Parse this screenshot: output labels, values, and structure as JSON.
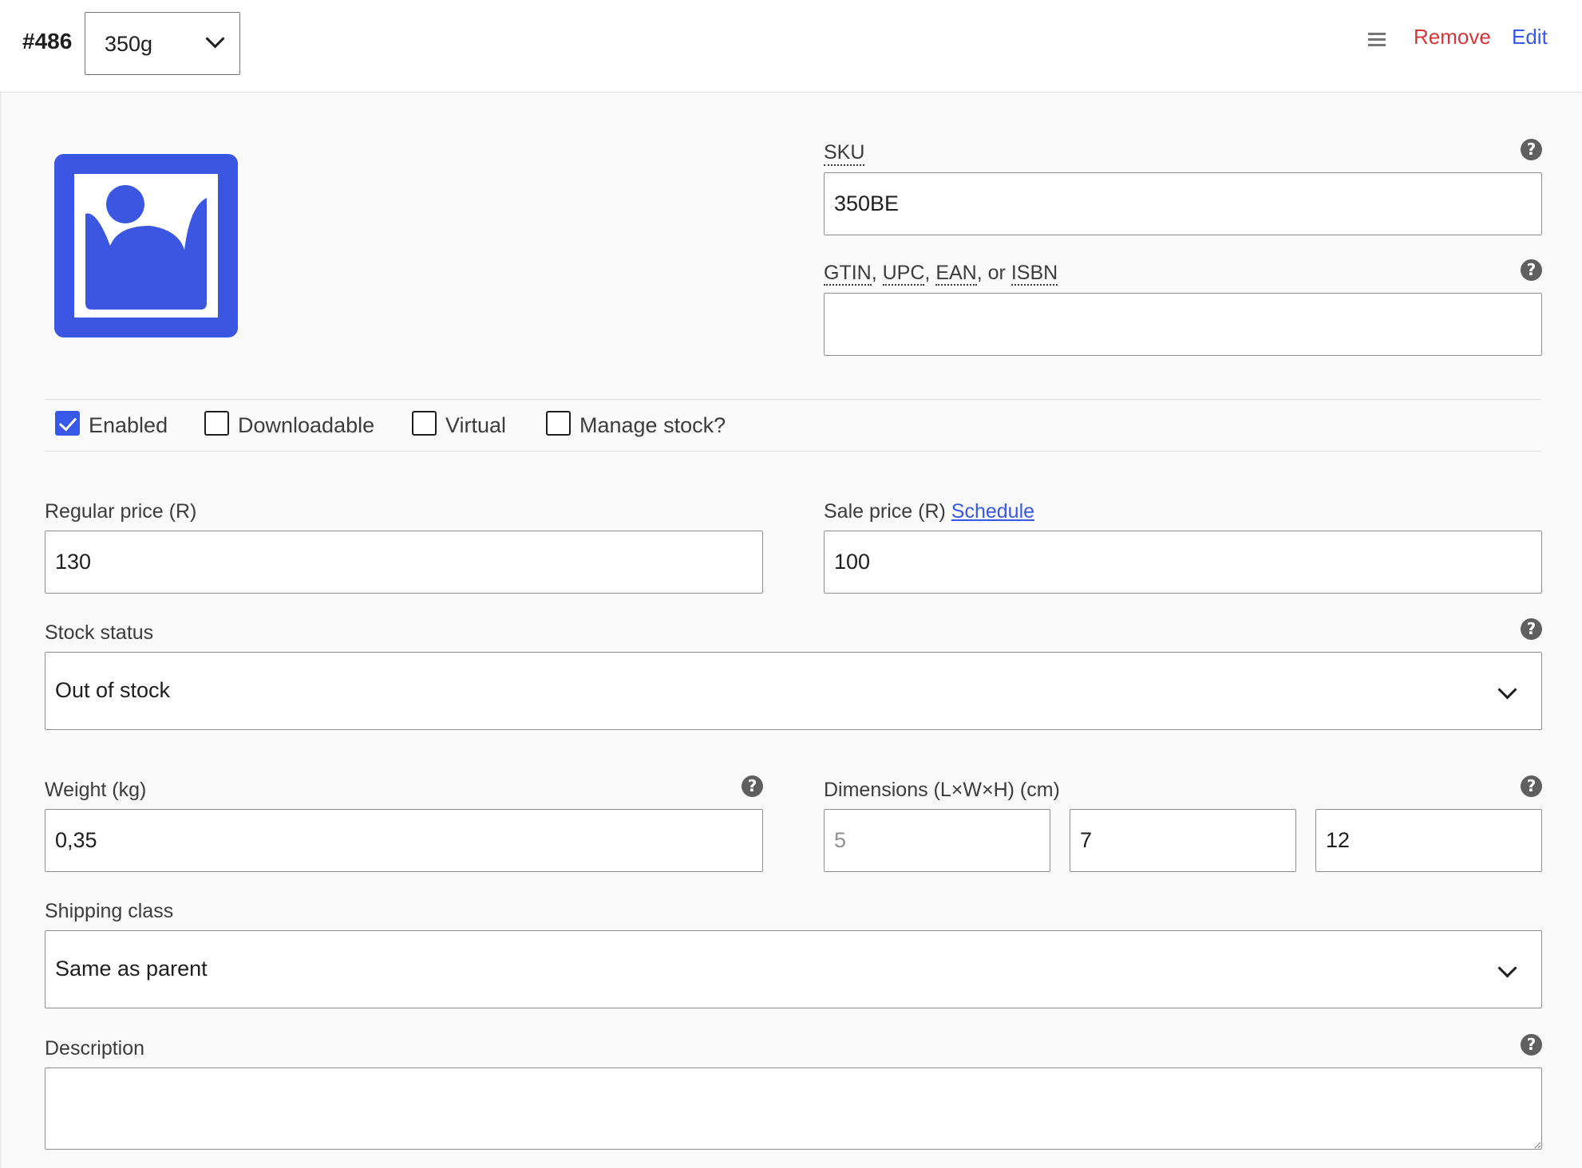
{
  "header": {
    "variation_id": "#486",
    "attribute_value": "350g",
    "remove_label": "Remove",
    "edit_label": "Edit"
  },
  "fields": {
    "sku": {
      "label": "SKU",
      "value": "350BE"
    },
    "gtin": {
      "label_parts": [
        "GTIN",
        "UPC",
        "EAN",
        "ISBN"
      ],
      "separator": ", ",
      "or_word": "or",
      "value": ""
    },
    "options": [
      {
        "label": "Enabled",
        "checked": true
      },
      {
        "label": "Downloadable",
        "checked": false
      },
      {
        "label": "Virtual",
        "checked": false
      },
      {
        "label": "Manage stock?",
        "checked": false
      }
    ],
    "regular_price": {
      "label": "Regular price (R)",
      "value": "130"
    },
    "sale_price": {
      "label": "Sale price (R)",
      "link": "Schedule",
      "value": "100"
    },
    "stock_status": {
      "label": "Stock status",
      "value": "Out of stock"
    },
    "weight": {
      "label": "Weight (kg)",
      "value": "0,35"
    },
    "dimensions": {
      "label": "Dimensions (L×W×H) (cm)",
      "length_placeholder": "5",
      "width": "7",
      "height": "12"
    },
    "shipping_class": {
      "label": "Shipping class",
      "value": "Same as parent"
    },
    "description": {
      "label": "Description",
      "value": ""
    }
  },
  "help_glyph": "?",
  "colors": {
    "accent": "#3858e9",
    "remove": "#d63638",
    "image_icon": "#3b56e0"
  },
  "icons": [
    "chevron-down-icon",
    "drag-handle-icon",
    "image-placeholder-icon",
    "help-icon",
    "check-icon"
  ]
}
